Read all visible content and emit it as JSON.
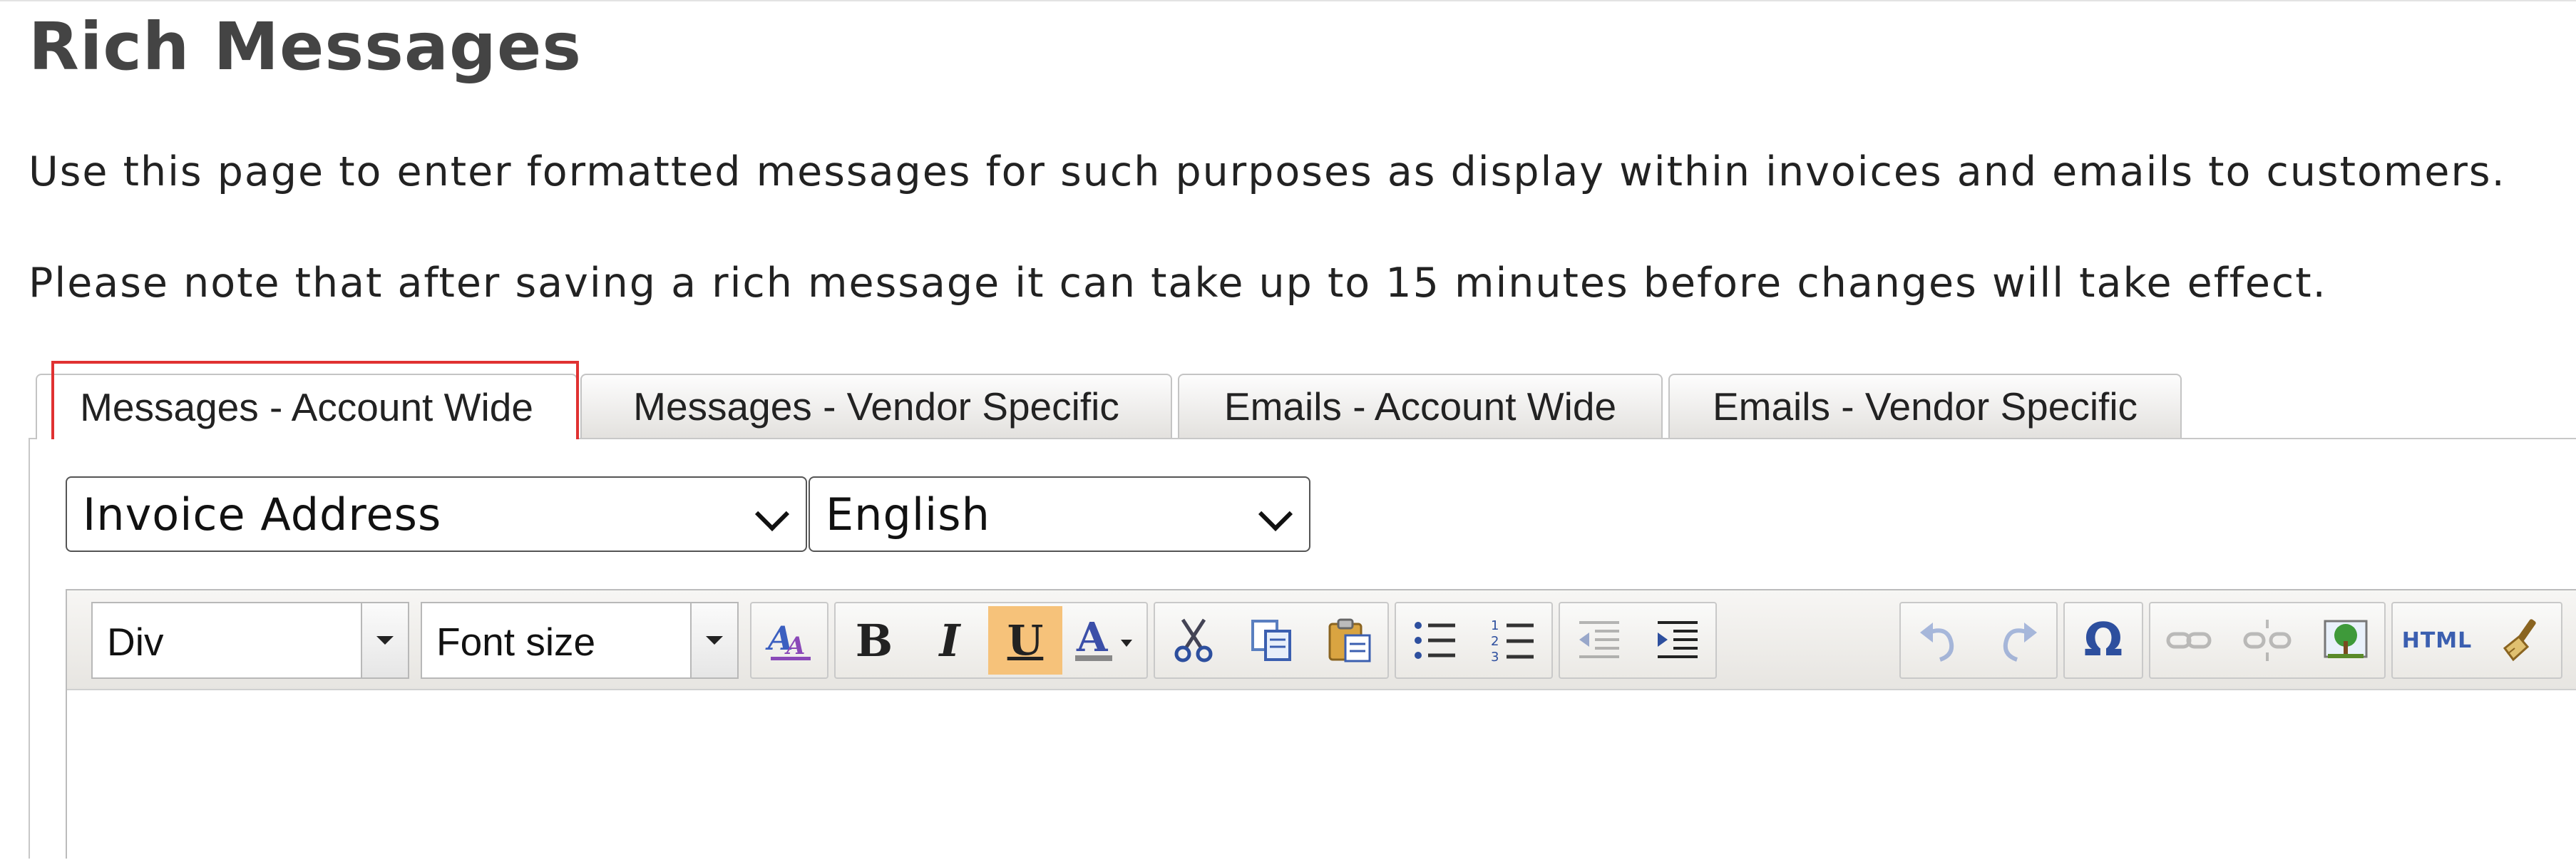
{
  "page": {
    "title": "Rich Messages",
    "description": "Use this page to enter formatted messages for such purposes as display within invoices and emails to customers.",
    "note": "Please note that after saving a rich message it can take up to 15 minutes before changes will take effect."
  },
  "tabs": [
    {
      "label": "Messages - Account Wide",
      "active": true
    },
    {
      "label": "Messages - Vendor Specific",
      "active": false
    },
    {
      "label": "Emails - Account Wide",
      "active": false
    },
    {
      "label": "Emails - Vendor Specific",
      "active": false
    }
  ],
  "selects": {
    "message_type": "Invoice Address",
    "language": "English"
  },
  "toolbar": {
    "format": "Div",
    "font_size": "Font size",
    "bold": "B",
    "italic": "I",
    "underline": "U",
    "text_color": "A",
    "special_char": "Ω",
    "html_source": "HTML",
    "underline_active": true
  },
  "colors": {
    "highlight_border": "#e03131",
    "active_button": "#f6c27a",
    "link_blue": "#2b5fb5"
  }
}
